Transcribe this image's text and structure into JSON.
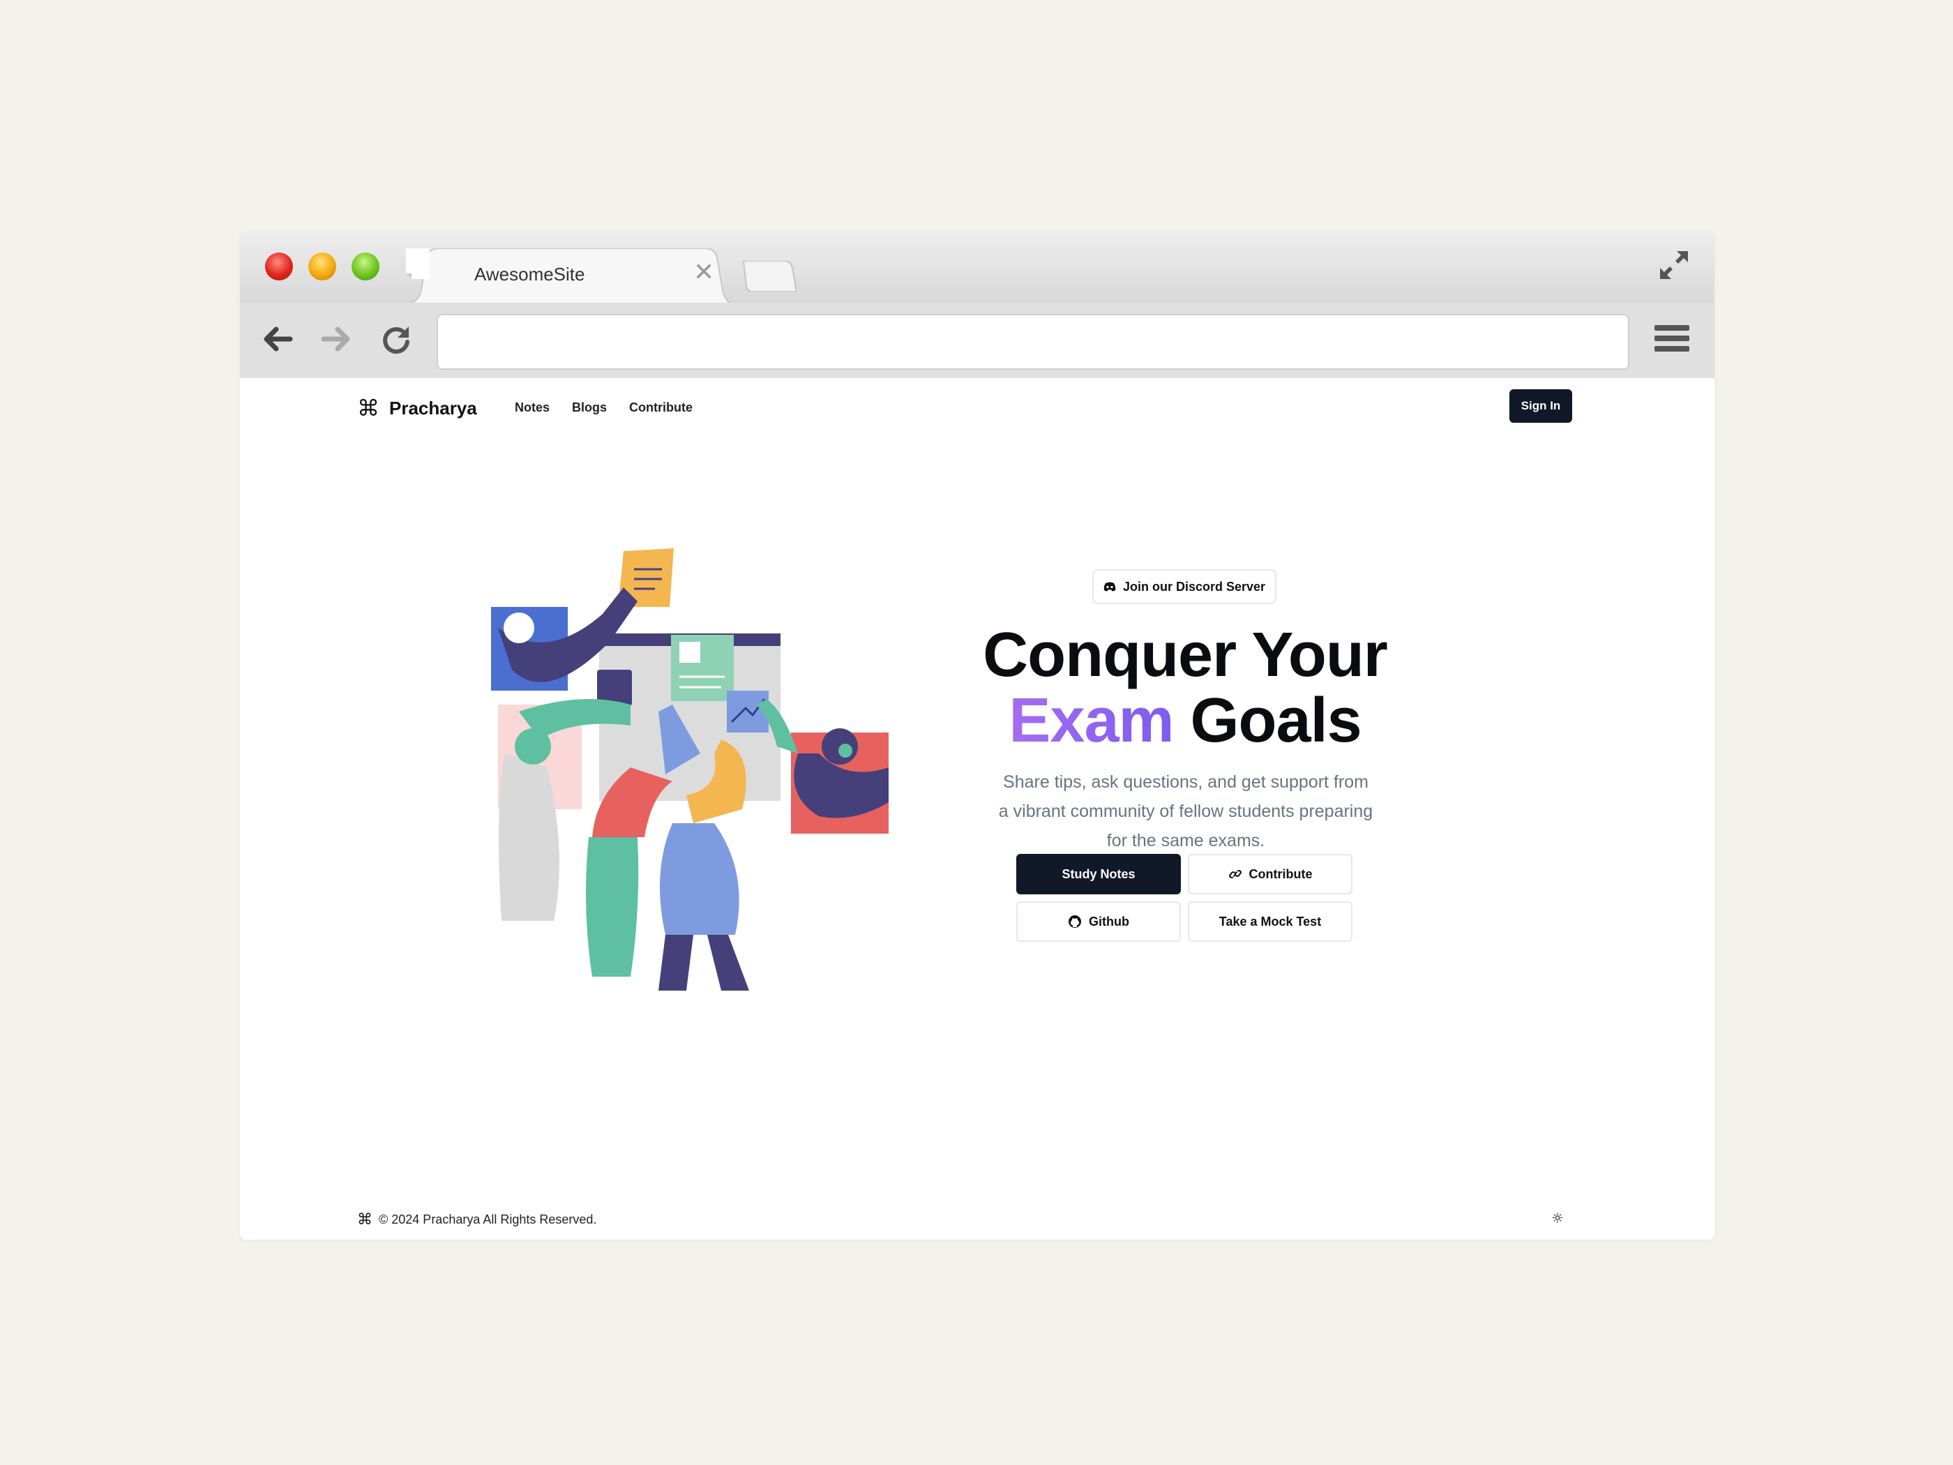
{
  "browser": {
    "tab_title": "AwesomeSite",
    "tab_close": "✕",
    "url": ""
  },
  "site": {
    "logo_icon": "⌘",
    "brand": "Pracharya",
    "nav": [
      "Notes",
      "Blogs",
      "Contribute"
    ],
    "signin_label": "Sign In"
  },
  "hero": {
    "discord_label": "Join our Discord Server",
    "title_line1": "Conquer Your",
    "title_accent": "Exam",
    "title_rest": " Goals",
    "subtitle": "Share tips, ask questions, and get support from a vibrant community of fellow students preparing for the same exams.",
    "buttons": {
      "study_notes": "Study Notes",
      "contribute": "Contribute",
      "github": "Github",
      "mock_test": "Take a Mock Test"
    }
  },
  "footer": {
    "icon": "⌘",
    "copyright": "© 2024 Pracharya All Rights Reserved.",
    "theme_icon": "☼"
  },
  "colors": {
    "primary_dark": "#111827",
    "accent_start": "#a56df0",
    "accent_end": "#7c5cf0",
    "text_muted": "#6b7280"
  },
  "icons": {
    "back": "back-arrow-icon",
    "forward": "forward-arrow-icon",
    "reload": "reload-icon",
    "menu": "hamburger-menu-icon",
    "fullscreen": "fullscreen-icon",
    "discord": "discord-icon",
    "link": "link-icon",
    "github": "github-icon"
  }
}
